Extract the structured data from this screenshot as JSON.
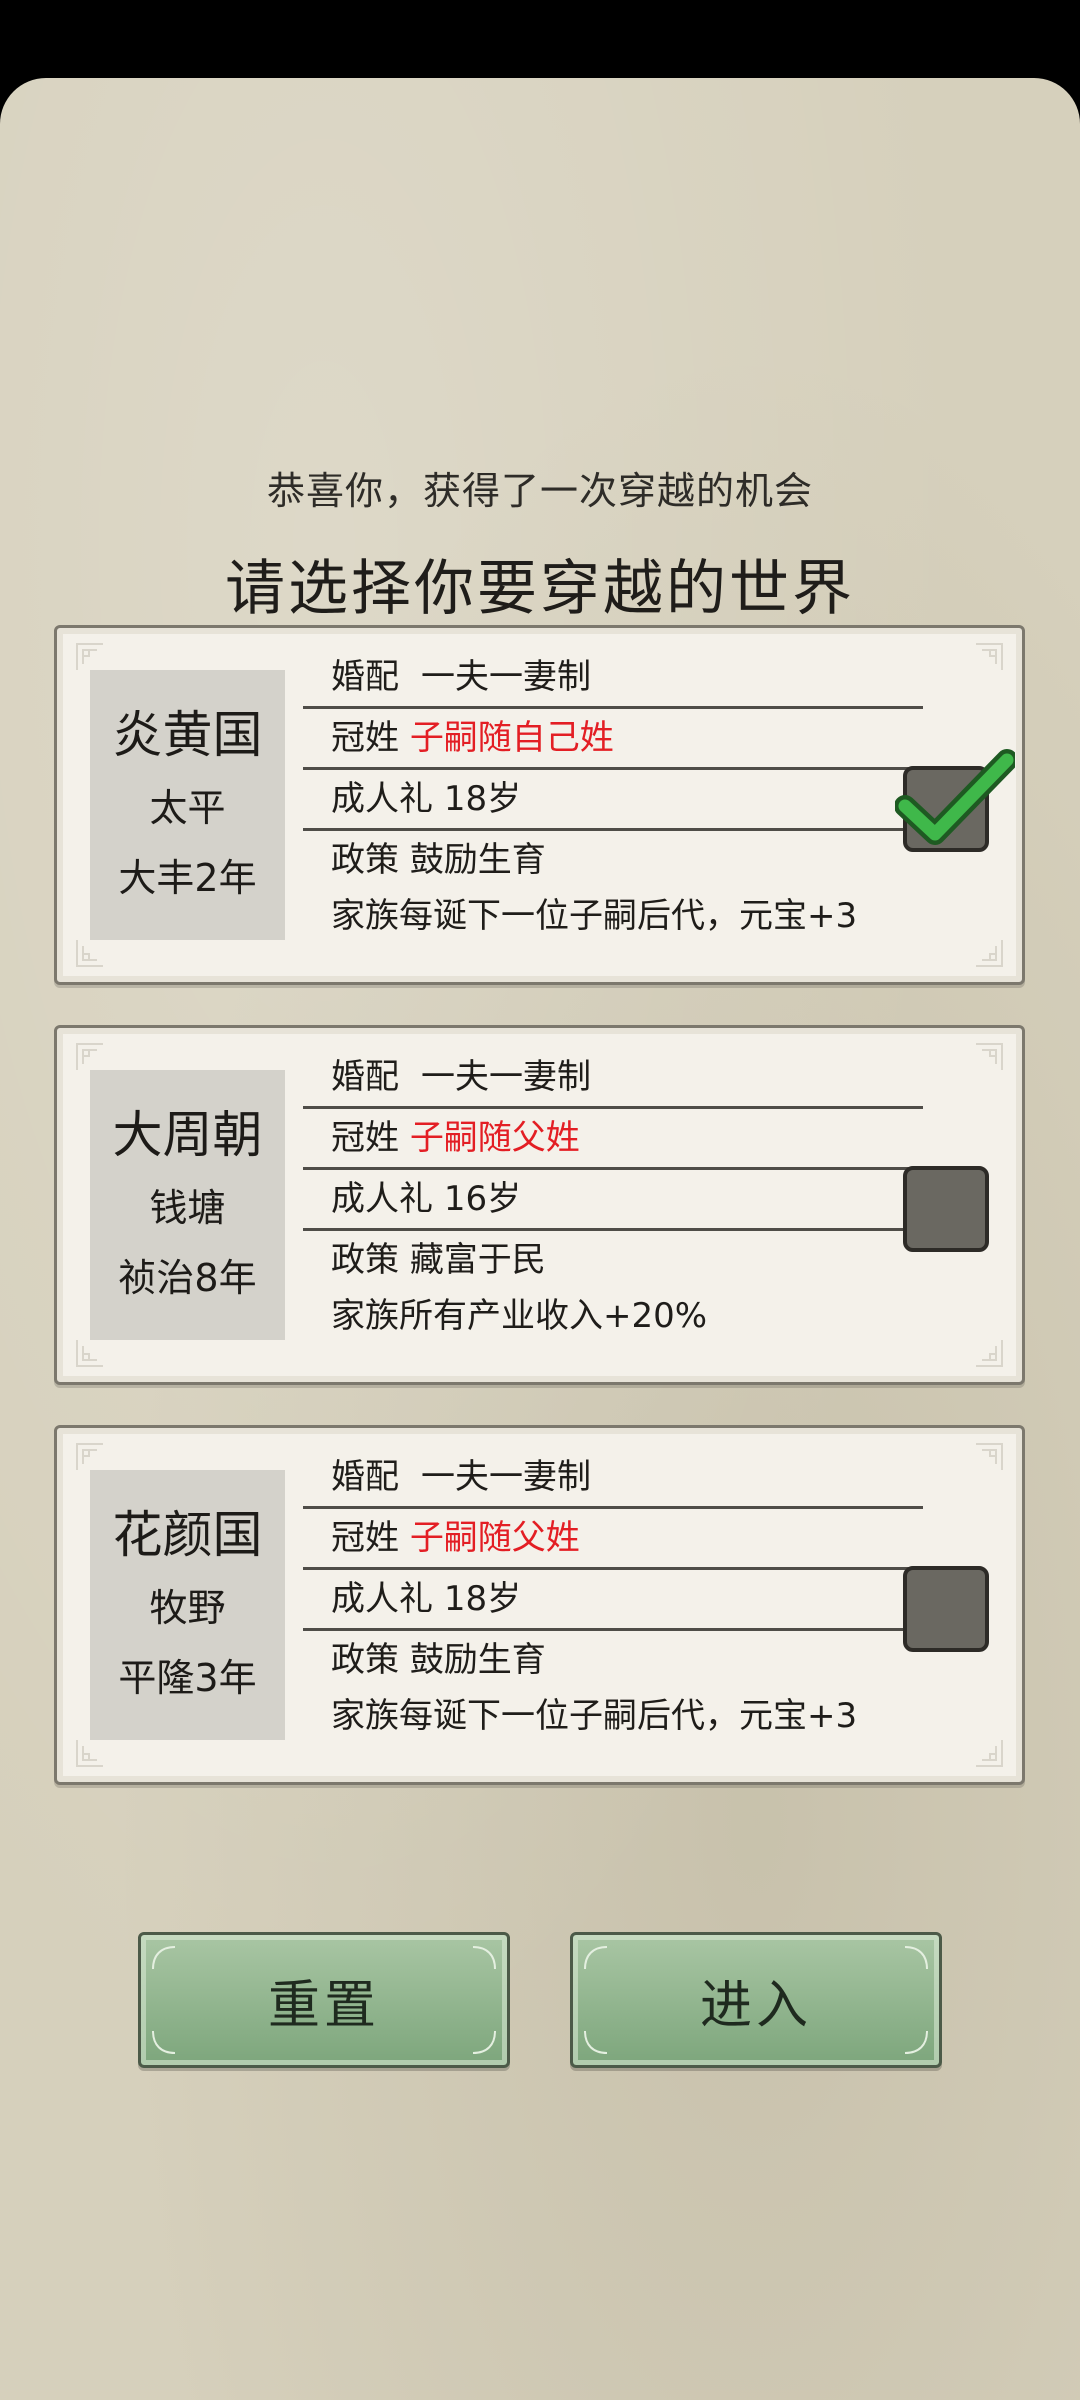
{
  "header": {
    "subtitle": "恭喜你，获得了一次穿越的机会",
    "title": "请选择你要穿越的世界"
  },
  "worlds": [
    {
      "name": "炎黄国",
      "place": "太平",
      "era": "大丰2年",
      "marriage_label": "婚配",
      "marriage_value": "一夫一妻制",
      "surname_label": "冠姓",
      "surname_value": "子嗣随自己姓",
      "adulthood_label": "成人礼",
      "adulthood_value": "18岁",
      "policy_label": "政策",
      "policy_value": "鼓励生育",
      "effect": "家族每诞下一位子嗣后代，元宝+3",
      "selected": true
    },
    {
      "name": "大周朝",
      "place": "钱塘",
      "era": "祯治8年",
      "marriage_label": "婚配",
      "marriage_value": "一夫一妻制",
      "surname_label": "冠姓",
      "surname_value": "子嗣随父姓",
      "adulthood_label": "成人礼",
      "adulthood_value": "16岁",
      "policy_label": "政策",
      "policy_value": "藏富于民",
      "effect": "家族所有产业收入+20%",
      "selected": false
    },
    {
      "name": "花颜国",
      "place": "牧野",
      "era": "平隆3年",
      "marriage_label": "婚配",
      "marriage_value": "一夫一妻制",
      "surname_label": "冠姓",
      "surname_value": "子嗣随父姓",
      "adulthood_label": "成人礼",
      "adulthood_value": "18岁",
      "policy_label": "政策",
      "policy_value": "鼓励生育",
      "effect": "家族每诞下一位子嗣后代，元宝+3",
      "selected": false
    }
  ],
  "buttons": {
    "reset": "重置",
    "enter": "进入"
  },
  "colors": {
    "panel_bg": "#d6d0bc",
    "card_bg": "#f4f1ea",
    "highlight_red": "#e31e24",
    "button_green": "#8fb48c",
    "check_green": "#3fb84a"
  }
}
